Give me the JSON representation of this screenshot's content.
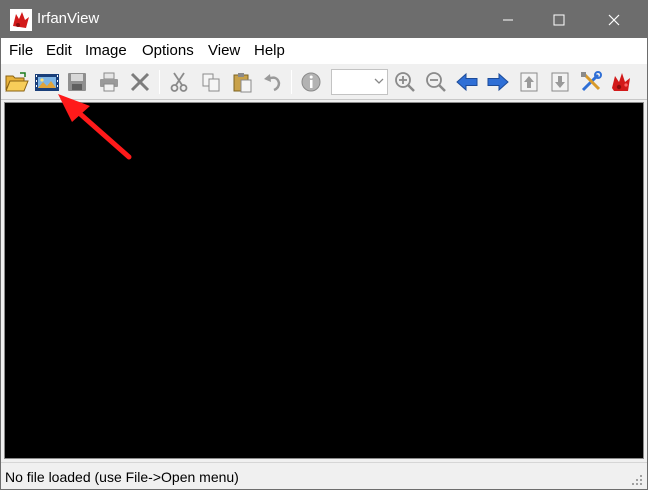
{
  "window": {
    "title": "IrfanView"
  },
  "menu": {
    "items": [
      "File",
      "Edit",
      "Image",
      "Options",
      "View",
      "Help"
    ]
  },
  "toolbar": {
    "zoom_value": "",
    "buttons": [
      "open-folder-icon",
      "slideshow-icon",
      "save-icon",
      "print-icon",
      "delete-icon",
      "cut-icon",
      "copy-icon",
      "paste-icon",
      "undo-icon",
      "info-icon",
      "zoom-in-icon",
      "zoom-out-icon",
      "previous-icon",
      "next-icon",
      "first-page-icon",
      "last-page-icon",
      "settings-icon",
      "irfanview-logo-icon"
    ]
  },
  "status": {
    "text": "No file loaded (use File->Open menu)"
  },
  "colors": {
    "titlebar": "#6d6d6d",
    "canvas": "#000000",
    "annotation_arrow": "#ff1a1a"
  }
}
